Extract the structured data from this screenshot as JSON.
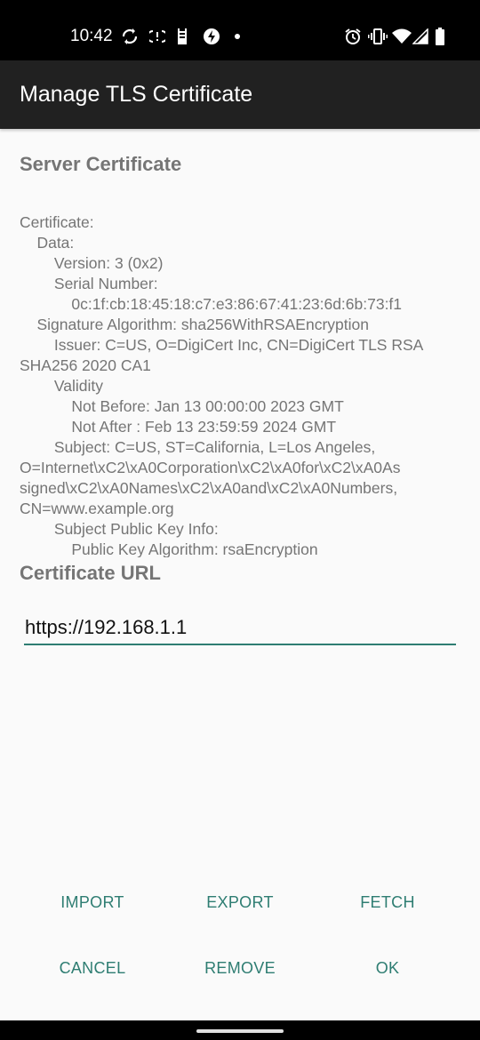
{
  "status_bar": {
    "time": "10:42",
    "left_icons": [
      "sync-icon",
      "data-saver-icon",
      "sim-card-icon",
      "bolt-icon",
      "dot-icon"
    ],
    "right_icons": [
      "alarm-icon",
      "vibrate-icon",
      "wifi-icon",
      "signal-icon",
      "battery-icon"
    ]
  },
  "app_bar": {
    "title": "Manage TLS Certificate"
  },
  "server_certificate": {
    "title": "Server Certificate",
    "lines": [
      "Certificate:",
      "    Data:",
      "        Version: 3 (0x2)",
      "        Serial Number:",
      "            0c:1f:cb:18:45:18:c7:e3:86:67:41:23:6d:6b:73:f1",
      "    Signature Algorithm: sha256WithRSAEncryption",
      "        Issuer: C=US, O=DigiCert Inc, CN=DigiCert TLS RSA",
      "SHA256 2020 CA1",
      "        Validity",
      "            Not Before: Jan 13 00:00:00 2023 GMT",
      "            Not After : Feb 13 23:59:59 2024 GMT",
      "        Subject: C=US, ST=California, L=Los Angeles,",
      "O=Internet\\xC2\\xA0Corporation\\xC2\\xA0for\\xC2\\xA0As",
      "signed\\xC2\\xA0Names\\xC2\\xA0and\\xC2\\xA0Numbers,",
      "CN=www.example.org",
      "        Subject Public Key Info:",
      "            Public Key Algorithm: rsaEncryption"
    ]
  },
  "certificate_url": {
    "title": "Certificate URL",
    "value": "https://192.168.1.1"
  },
  "buttons": {
    "import": "IMPORT",
    "export": "EXPORT",
    "fetch": "FETCH",
    "cancel": "CANCEL",
    "remove": "REMOVE",
    "ok": "OK"
  },
  "colors": {
    "accent": "#2e7d72",
    "app_bar": "#212121",
    "secondary_text": "#757575"
  }
}
